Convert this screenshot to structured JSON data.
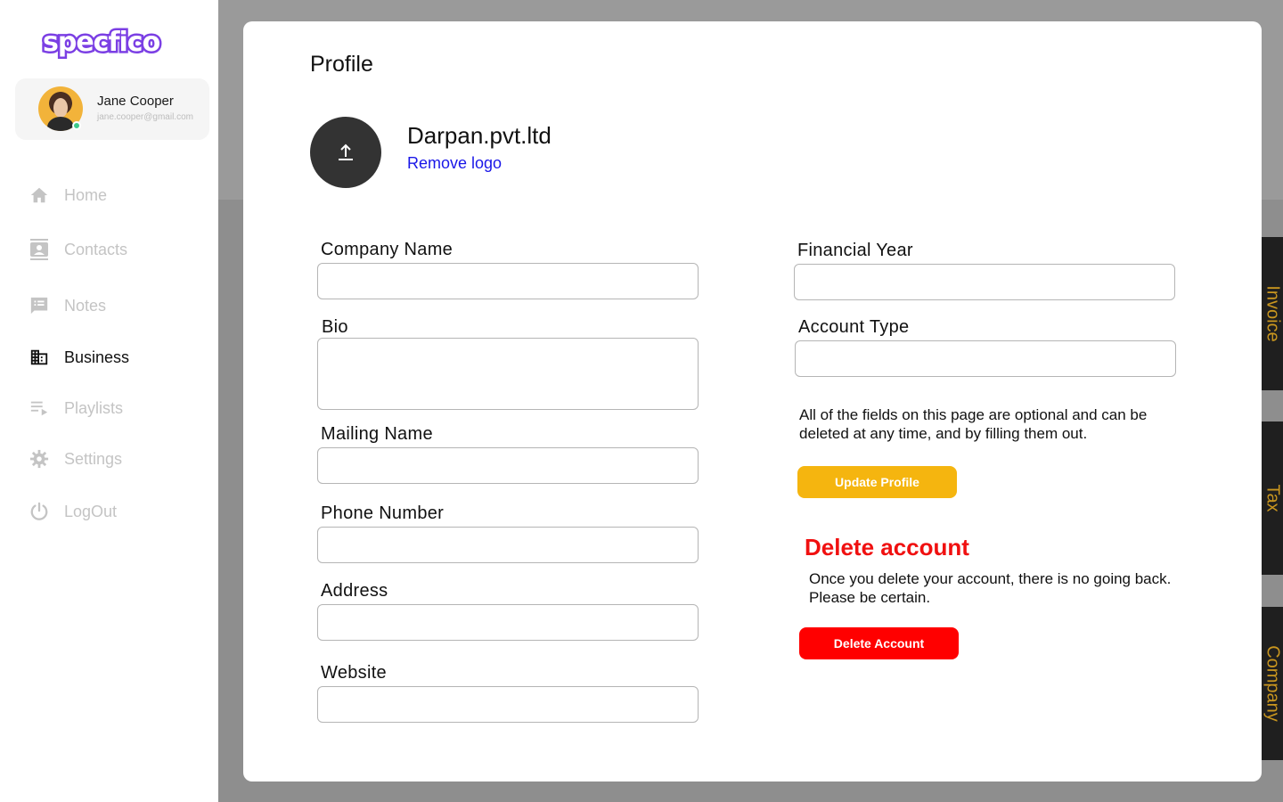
{
  "app": {
    "logo_text": "specfico",
    "brand_color": "#7b3fe4"
  },
  "user": {
    "name": "Jane Cooper",
    "email": "jane.cooper@gmail.com",
    "status": "online"
  },
  "nav": {
    "items": [
      {
        "label": "Home",
        "icon": "home-icon",
        "active": false
      },
      {
        "label": "Contacts",
        "icon": "contacts-icon",
        "active": false
      },
      {
        "label": "Notes",
        "icon": "notes-icon",
        "active": false
      },
      {
        "label": "Business",
        "icon": "business-icon",
        "active": true
      },
      {
        "label": "Playlists",
        "icon": "playlist-icon",
        "active": false
      },
      {
        "label": "Settings",
        "icon": "gear-icon",
        "active": false
      },
      {
        "label": "LogOut",
        "icon": "power-icon",
        "active": false
      }
    ]
  },
  "profile": {
    "title": "Profile",
    "company_title": "Darpan.pvt.ltd",
    "remove_logo": "Remove logo",
    "upload_icon": "upload-icon"
  },
  "form": {
    "company_name": {
      "label": "Company Name",
      "value": ""
    },
    "bio": {
      "label": "Bio",
      "value": ""
    },
    "mailing_name": {
      "label": "Mailing Name",
      "value": ""
    },
    "phone_number": {
      "label": "Phone Number",
      "value": ""
    },
    "address": {
      "label": "Address",
      "value": ""
    },
    "website": {
      "label": "Website",
      "value": ""
    },
    "financial_year": {
      "label": "Financial Year",
      "value": ""
    },
    "account_type": {
      "label": "Account Type",
      "value": ""
    }
  },
  "notes": {
    "optional_fields": "All of the fields on this page are optional and can be deleted at any time, and by filling them out."
  },
  "actions": {
    "update_label": "Update Profile",
    "update_color": "#f5b50f",
    "delete_title": "Delete account",
    "delete_note": "Once you delete your account, there is no going back. Please be certain.",
    "delete_label": "Delete Account",
    "delete_color": "#ff0000"
  },
  "side_tabs": [
    {
      "label": "Invoice"
    },
    {
      "label": "Tax"
    },
    {
      "label": "Company"
    }
  ]
}
